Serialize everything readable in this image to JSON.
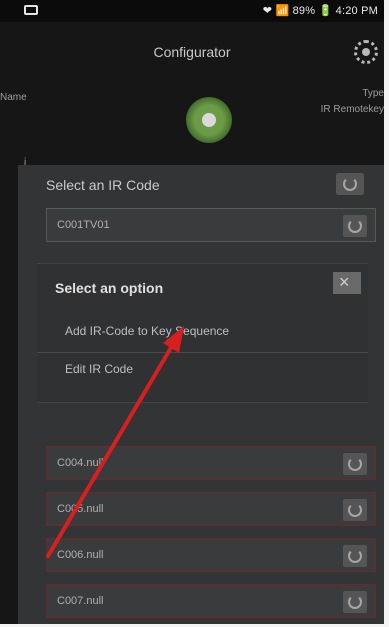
{
  "status_bar": {
    "text": "❤ 📶 89% 🔋 4:20 PM"
  },
  "app_bar": {
    "title": "Configurator"
  },
  "header": {
    "name_label": "Name",
    "type_label": "Type",
    "type_value": "IR Remotekey"
  },
  "mark": "i",
  "panel": {
    "title": "Select an IR Code",
    "codes": [
      {
        "label": "C001TV01"
      },
      {
        "label": "C004.null"
      },
      {
        "label": "C005.null"
      },
      {
        "label": "C006.null"
      },
      {
        "label": "C007.null"
      }
    ]
  },
  "dialog": {
    "title": "Select an option",
    "close": "×",
    "options": [
      {
        "label": "Add IR-Code to Key Sequence"
      },
      {
        "label": "Edit IR Code"
      }
    ]
  },
  "colors": {
    "annotation_arrow": "#d81f1f",
    "device_green": "#6c9b48"
  },
  "icons": {
    "settings": "settings-icon",
    "device": "ir-device-icon",
    "refresh": "refresh-icon",
    "close": "close-icon"
  }
}
